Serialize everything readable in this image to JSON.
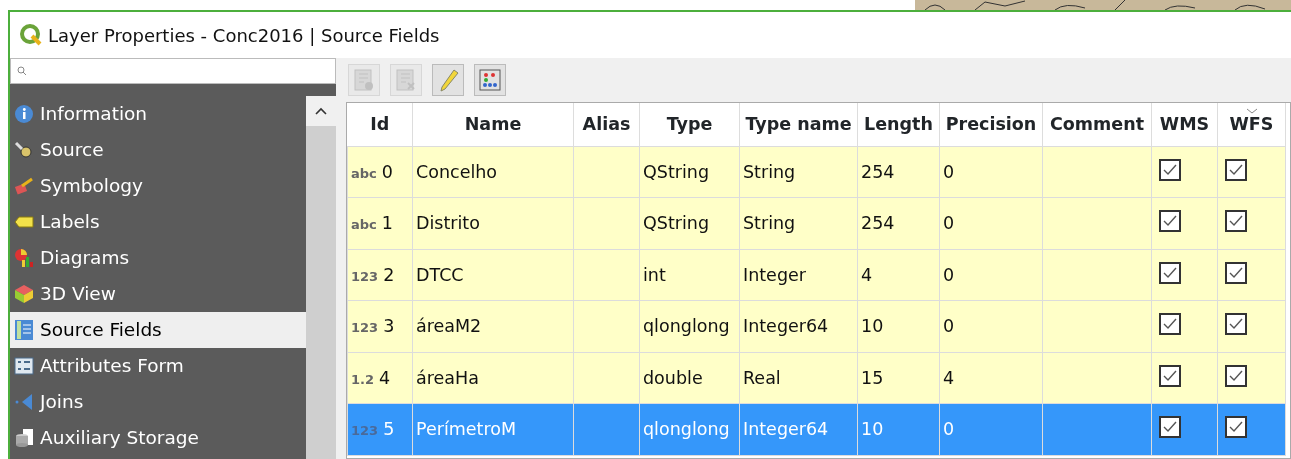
{
  "window": {
    "title": "Layer Properties - Conc2016 | Source Fields"
  },
  "sidebar": {
    "items": [
      {
        "label": "Information",
        "selected": false
      },
      {
        "label": "Source",
        "selected": false
      },
      {
        "label": "Symbology",
        "selected": false
      },
      {
        "label": "Labels",
        "selected": false
      },
      {
        "label": "Diagrams",
        "selected": false
      },
      {
        "label": "3D View",
        "selected": false
      },
      {
        "label": "Source Fields",
        "selected": true
      },
      {
        "label": "Attributes Form",
        "selected": false
      },
      {
        "label": "Joins",
        "selected": false
      },
      {
        "label": "Auxiliary Storage",
        "selected": false
      }
    ]
  },
  "toolbar": [
    {
      "disabled": true
    },
    {
      "disabled": true
    },
    {
      "disabled": false
    },
    {
      "disabled": false
    }
  ],
  "table": {
    "columns": [
      "Id",
      "Name",
      "Alias",
      "Type",
      "Type name",
      "Length",
      "Precision",
      "Comment",
      "WMS",
      "WFS"
    ],
    "rows": [
      {
        "type_icon": "abc",
        "id": "0",
        "name": "Concelho",
        "type": "QString",
        "type_name": "String",
        "length": "254",
        "precision": "0",
        "wms": true,
        "wfs": true,
        "selected": false
      },
      {
        "type_icon": "abc",
        "id": "1",
        "name": "Distrito",
        "type": "QString",
        "type_name": "String",
        "length": "254",
        "precision": "0",
        "wms": true,
        "wfs": true,
        "selected": false
      },
      {
        "type_icon": "123",
        "id": "2",
        "name": "DTCC",
        "type": "int",
        "type_name": "Integer",
        "length": "4",
        "precision": "0",
        "wms": true,
        "wfs": true,
        "selected": false
      },
      {
        "type_icon": "123",
        "id": "3",
        "name": "áreaM2",
        "type": "qlonglong",
        "type_name": "Integer64",
        "length": "10",
        "precision": "0",
        "wms": true,
        "wfs": true,
        "selected": false
      },
      {
        "type_icon": "1.2",
        "id": "4",
        "name": "áreaHa",
        "type": "double",
        "type_name": "Real",
        "length": "15",
        "precision": "4",
        "wms": true,
        "wfs": true,
        "selected": false
      },
      {
        "type_icon": "123",
        "id": "5",
        "name": "PerímetroM",
        "type": "qlonglong",
        "type_name": "Integer64",
        "length": "10",
        "precision": "0",
        "wms": true,
        "wfs": true,
        "selected": true
      }
    ]
  }
}
